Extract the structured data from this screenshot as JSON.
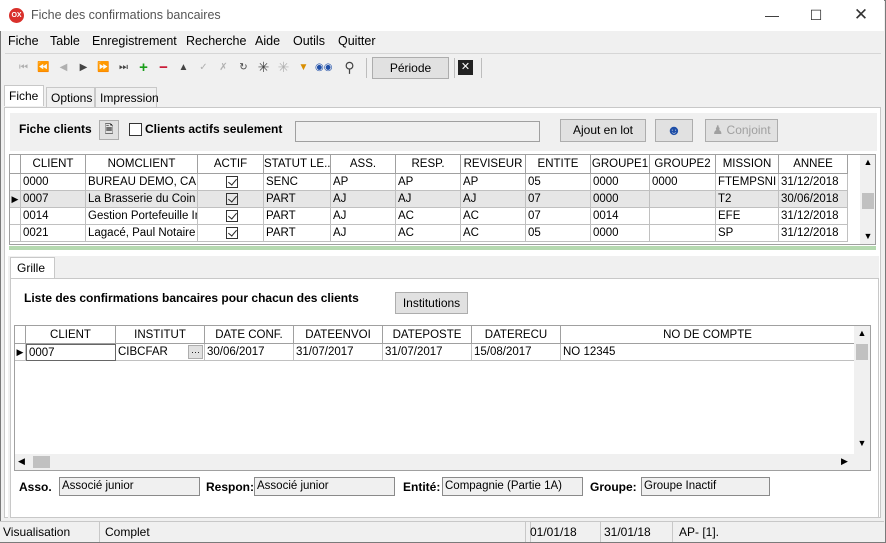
{
  "window": {
    "title": "Fiche des confirmations bancaires",
    "app_icon_text": "OX"
  },
  "menu": [
    "Fiche",
    "Table",
    "Enregistrement",
    "Recherche",
    "Aide",
    "Outils",
    "Quitter"
  ],
  "toolbar": {
    "periode_label": "Période"
  },
  "tabs": [
    "Fiche",
    "Options",
    "Impression"
  ],
  "fiche": {
    "label": "Fiche clients",
    "actifs_label": "Clients actifs seulement",
    "search_value": "",
    "ajout_label": "Ajout en lot",
    "conjoint_label": "Conjoint"
  },
  "clients_grid": {
    "headers": [
      "CLIENT",
      "NOMCLIENT",
      "ACTIF",
      "STATUT LE...",
      "ASS.",
      "RESP.",
      "REVISEUR",
      "ENTITE",
      "GROUPE1",
      "GROUPE2",
      "MISSION",
      "ANNEE"
    ],
    "rows": [
      {
        "selected": false,
        "cells": [
          "0000",
          "BUREAU DEMO, CA",
          "",
          "SENC",
          "AP",
          "AP",
          "AP",
          "05",
          "0000",
          "0000",
          "FTEMPSNI",
          "31/12/2018"
        ],
        "actif": true
      },
      {
        "selected": true,
        "cells": [
          "0007",
          "La Brasserie du Coin Inc.",
          "",
          "PART",
          "AJ",
          "AJ",
          "AJ",
          "07",
          "0000",
          "",
          "T2",
          "30/06/2018"
        ],
        "actif": true
      },
      {
        "selected": false,
        "cells": [
          "0014",
          "Gestion Portefeuille Inc",
          "",
          "PART",
          "AJ",
          "AC",
          "AC",
          "07",
          "0014",
          "",
          "EFE",
          "31/12/2018"
        ],
        "actif": true
      },
      {
        "selected": false,
        "cells": [
          "0021",
          "Lagacé, Paul Notaire",
          "",
          "PART",
          "AJ",
          "AC",
          "AC",
          "05",
          "0000",
          "",
          "SP",
          "31/12/2018"
        ],
        "actif": true
      }
    ]
  },
  "grille": {
    "tab_label": "Grille",
    "heading": "Liste des confirmations bancaires pour chacun des clients",
    "institutions_label": "Institutions",
    "headers": [
      "CLIENT",
      "INSTITUT",
      "DATE CONF.",
      "DATEENVOI",
      "DATEPOSTE",
      "DATERECU",
      "NO DE COMPTE"
    ],
    "rows": [
      {
        "cells": [
          "0007",
          "CIBCFAR",
          "30/06/2017",
          "31/07/2017",
          "31/07/2017",
          "15/08/2017",
          "NO 12345"
        ]
      }
    ],
    "ellipsis": "···"
  },
  "footer_fields": [
    {
      "label": "Asso.",
      "value": "Associé junior"
    },
    {
      "label": "Respon:",
      "value": "Associé junior"
    },
    {
      "label": "Entité:",
      "value": "Compagnie (Partie 1A)"
    },
    {
      "label": "Groupe:",
      "value": "Groupe Inactif"
    }
  ],
  "statusbar": [
    "Visualisation",
    "Complet",
    "",
    "01/01/18",
    "31/01/18",
    "AP- [1]."
  ],
  "colors": {
    "accent_red": "#d9302b",
    "header_border": "#a0a0a0",
    "selected_row": "#e6e6e6"
  }
}
